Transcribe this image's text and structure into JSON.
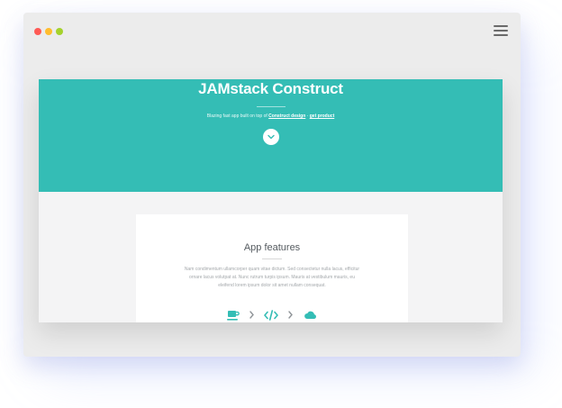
{
  "hero": {
    "title": "JAMstack Construct",
    "subtitle_prefix": "Blazing fast app built on top of ",
    "link_design": "Construct design",
    "subtitle_sep": " - ",
    "link_product": "get product"
  },
  "features": {
    "title": "App features",
    "description": "Nam condimentum ullamcorper quam vitae dictum. Sed consectetur nulla lacus, efficitur ornare lacus volutpat at. Nunc rutrum turpis ipsum. Mauris at vestibulum mauris, eu eleifend lorem ipsum dolor sit amet nullam consequat."
  },
  "colors": {
    "accent": "#34bdb5",
    "window_bg": "#ececec",
    "page_bg": "#f4f4f5",
    "dot_red": "#ff5a55",
    "dot_yellow": "#ffbd2e",
    "dot_green": "#a5d22c"
  },
  "icons": [
    "coffee-icon",
    "chevron-right-icon",
    "code-icon",
    "chevron-right-icon",
    "cloud-icon",
    "chevron-down-icon",
    "menu-icon"
  ]
}
